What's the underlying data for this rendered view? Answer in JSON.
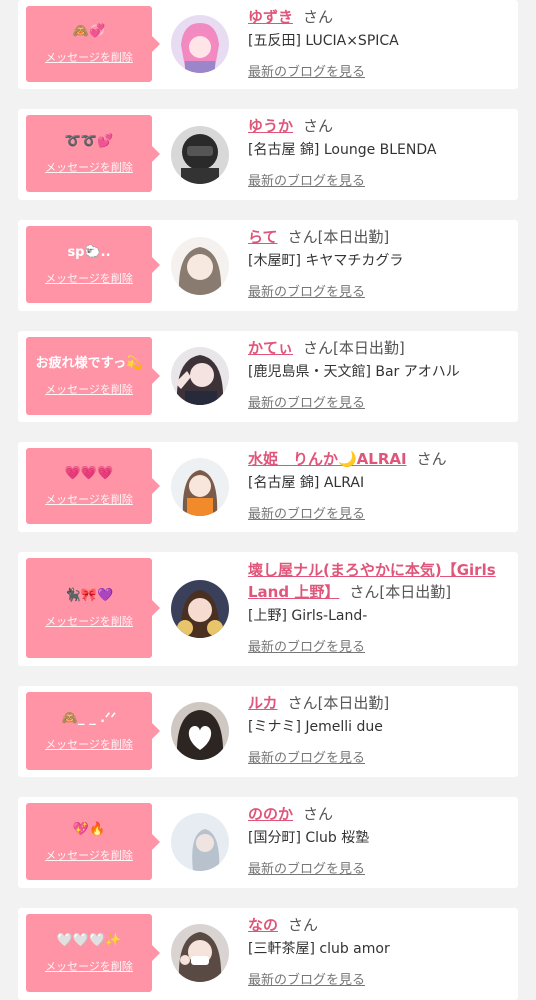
{
  "cards": [
    {
      "message": "🙈💞",
      "delete_label": "メッセージを削除",
      "name": "ゆずき",
      "suffix": "さん",
      "status": "",
      "shop": "[五反田] LUCIA×SPICA",
      "blog": "最新のブログを見る"
    },
    {
      "message": "➰➰💕",
      "delete_label": "メッセージを削除",
      "name": "ゆうか",
      "suffix": "さん",
      "status": "",
      "shop": "[名古屋 錦] Lounge BLENDA",
      "blog": "最新のブログを見る"
    },
    {
      "message": "sp🐑..",
      "delete_label": "メッセージを削除",
      "name": "らて",
      "suffix": "さん",
      "status": "[本日出勤]",
      "shop": "[木屋町] キヤマチカグラ",
      "blog": "最新のブログを見る"
    },
    {
      "message": "お疲れ様ですっ💫",
      "delete_label": "メッセージを削除",
      "name": "かてぃ",
      "suffix": "さん",
      "status": "[本日出勤]",
      "shop": "[鹿児島県・天文館] Bar アオハル",
      "blog": "最新のブログを見る"
    },
    {
      "message": "💗💗💗",
      "delete_label": "メッセージを削除",
      "name": "水姫　りんか🌙ALRAI",
      "suffix": "さん",
      "status": "",
      "shop": "[名古屋 錦] ALRAI",
      "blog": "最新のブログを見る"
    },
    {
      "message": "🐈‍⬛🎀💜",
      "delete_label": "メッセージを削除",
      "name": "壊し屋ナル(まろやかに本気)【Girls Land 上野】",
      "suffix": "さん",
      "status": "[本日出勤]",
      "shop": "[上野] Girls-Land-",
      "blog": "最新のブログを見る"
    },
    {
      "message": "🙈_ _ .ᐟᐟ",
      "delete_label": "メッセージを削除",
      "name": "ルカ",
      "suffix": "さん",
      "status": "[本日出勤]",
      "shop": "[ミナミ] Jemelli due",
      "blog": "最新のブログを見る"
    },
    {
      "message": "💖🔥",
      "delete_label": "メッセージを削除",
      "name": "ののか",
      "suffix": "さん",
      "status": "",
      "shop": "[国分町] Club 桜塾",
      "blog": "最新のブログを見る"
    },
    {
      "message": "🤍🤍🤍✨",
      "delete_label": "メッセージを削除",
      "name": "なの",
      "suffix": "さん",
      "status": "",
      "shop": "[三軒茶屋] club amor",
      "blog": "最新のブログを見る"
    }
  ]
}
